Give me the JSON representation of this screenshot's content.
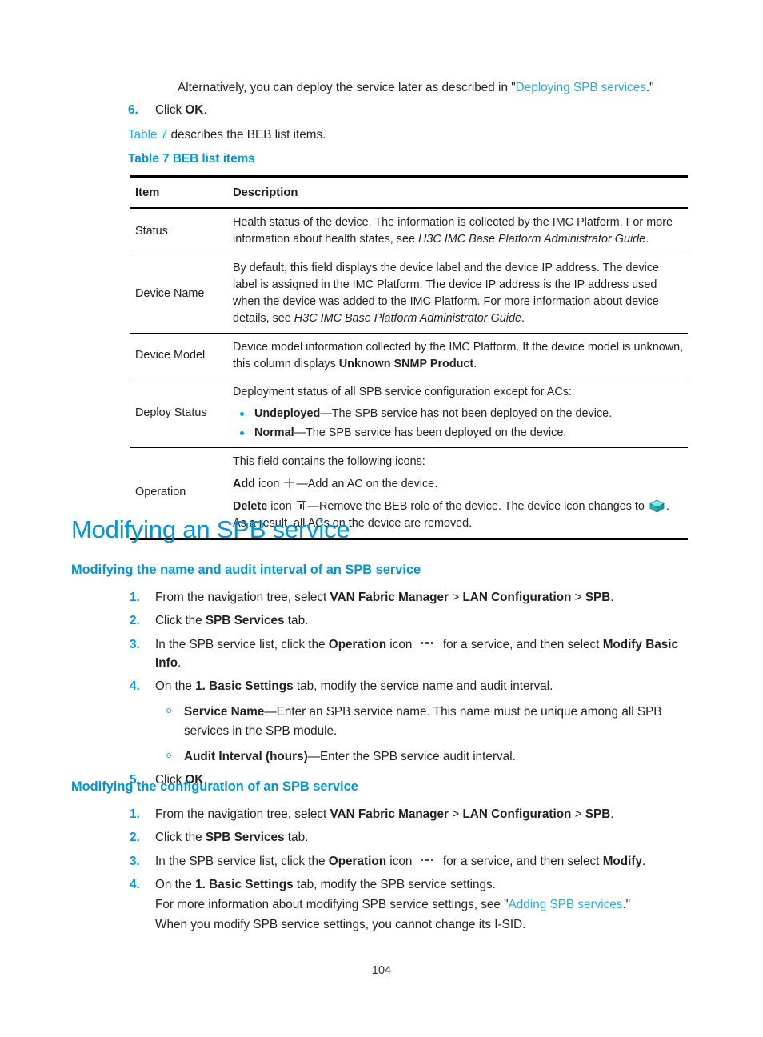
{
  "document": {
    "page_number": "104"
  },
  "intro": {
    "alt_text_before": "Alternatively, you can deploy the service later as described in \"",
    "alt_link": "Deploying SPB services",
    "alt_text_after": ".\"",
    "step6_num": "6.",
    "step6_text_before": "Click ",
    "step6_bold": "OK",
    "step6_text_after": ".",
    "table_ref_link": "Table 7",
    "table_ref_text": " describes the BEB list items.",
    "table_caption": "Table 7 BEB list items"
  },
  "table": {
    "headers": [
      "Item",
      "Description"
    ],
    "rows": [
      {
        "item": "Status",
        "desc_parts": [
          {
            "t": "Health status of the device. The information is collected by the IMC Platform. For more information about health states, see "
          },
          {
            "t": "H3C IMC Base Platform Administrator Guide",
            "style": "italic"
          },
          {
            "t": "."
          }
        ]
      },
      {
        "item": "Device Name",
        "desc_parts": [
          {
            "t": "By default, this field displays the device label and the device IP address. The device label is assigned in the IMC Platform. The device IP address is the IP address used when the device was added to the IMC Platform. For more information about device details, see "
          },
          {
            "t": "H3C IMC Base Platform Administrator Guide",
            "style": "italic"
          },
          {
            "t": "."
          }
        ]
      },
      {
        "item": "Device Model",
        "desc_parts": [
          {
            "t": "Device model information collected by the IMC Platform. If the device model is unknown, this column displays "
          },
          {
            "t": "Unknown SNMP Product",
            "style": "bold"
          },
          {
            "t": "."
          }
        ]
      },
      {
        "item": "Deploy Status",
        "lead": "Deployment status of all SPB service configuration except for ACs:",
        "bullets": [
          {
            "bold": "Undeployed",
            "rest": "—The SPB service has not been deployed on the device."
          },
          {
            "bold": "Normal",
            "rest": "—The SPB service has been deployed on the device."
          }
        ]
      },
      {
        "item": "Operation",
        "op_lead": "This field contains the following icons:",
        "op_add_bold": "Add",
        "op_add_mid": " icon ",
        "op_add_rest": "—Add an AC on the device.",
        "op_del_bold": "Delete",
        "op_del_mid": " icon ",
        "op_del_rest_1": "—Remove the BEB role of the device. The device icon changes to ",
        "op_del_rest_2": ". As a result, all ACs on the device are removed."
      }
    ]
  },
  "section": {
    "h1": "Modifying an SPB service",
    "sub1": {
      "heading": "Modifying the name and audit interval of an SPB service",
      "steps": [
        {
          "num": "1.",
          "parts": [
            {
              "t": "From the navigation tree, select "
            },
            {
              "t": "VAN Fabric Manager",
              "style": "bold"
            },
            {
              "t": " > "
            },
            {
              "t": "LAN Configuration",
              "style": "bold"
            },
            {
              "t": " > "
            },
            {
              "t": "SPB",
              "style": "bold"
            },
            {
              "t": "."
            }
          ]
        },
        {
          "num": "2.",
          "parts": [
            {
              "t": "Click the "
            },
            {
              "t": "SPB Services",
              "style": "bold"
            },
            {
              "t": " tab."
            }
          ]
        },
        {
          "num": "3.",
          "parts": [
            {
              "t": "In the SPB service list, click the "
            },
            {
              "t": "Operation",
              "style": "bold"
            },
            {
              "t": " icon "
            },
            {
              "t": "",
              "style": "icon-ellipsis"
            },
            {
              "t": " for a service, and then select "
            },
            {
              "t": "Modify Basic Info",
              "style": "bold"
            },
            {
              "t": "."
            }
          ]
        },
        {
          "num": "4.",
          "parts": [
            {
              "t": "On the "
            },
            {
              "t": "1. Basic Settings",
              "style": "bold"
            },
            {
              "t": " tab, modify the service name and audit interval."
            }
          ],
          "subs": [
            {
              "bold": "Service Name",
              "rest": "—Enter an SPB service name. This name must be unique among all SPB services in the SPB module."
            },
            {
              "bold": "Audit Interval (hours)",
              "rest": "—Enter the SPB service audit interval."
            }
          ]
        },
        {
          "num": "5.",
          "parts": [
            {
              "t": "Click "
            },
            {
              "t": "OK",
              "style": "bold"
            },
            {
              "t": "."
            }
          ]
        }
      ]
    },
    "sub2": {
      "heading": "Modifying the configuration of an SPB service",
      "steps": [
        {
          "num": "1.",
          "parts": [
            {
              "t": "From the navigation tree, select "
            },
            {
              "t": "VAN Fabric Manager",
              "style": "bold"
            },
            {
              "t": " > "
            },
            {
              "t": "LAN Configuration",
              "style": "bold"
            },
            {
              "t": " > "
            },
            {
              "t": "SPB",
              "style": "bold"
            },
            {
              "t": "."
            }
          ]
        },
        {
          "num": "2.",
          "parts": [
            {
              "t": "Click the "
            },
            {
              "t": "SPB Services",
              "style": "bold"
            },
            {
              "t": " tab."
            }
          ]
        },
        {
          "num": "3.",
          "parts": [
            {
              "t": "In the SPB service list, click the "
            },
            {
              "t": "Operation",
              "style": "bold"
            },
            {
              "t": " icon "
            },
            {
              "t": "",
              "style": "icon-ellipsis"
            },
            {
              "t": " for a service, and then select "
            },
            {
              "t": "Modify",
              "style": "bold"
            },
            {
              "t": "."
            }
          ]
        },
        {
          "num": "4.",
          "parts": [
            {
              "t": "On the "
            },
            {
              "t": "1. Basic Settings",
              "style": "bold"
            },
            {
              "t": " tab, modify the SPB service settings."
            }
          ],
          "notes": [
            [
              {
                "t": "For more information about modifying SPB service settings, see \""
              },
              {
                "t": "Adding SPB services",
                "style": "link"
              },
              {
                "t": ".\""
              }
            ],
            [
              {
                "t": "When you modify SPB service settings, you cannot change its I-SID."
              }
            ]
          ]
        }
      ]
    }
  },
  "colors": {
    "heading_blue": "#0096d6",
    "link_blue": "#29a9e0",
    "text": "#231f20",
    "cube_icon": "#2ec3c3"
  }
}
